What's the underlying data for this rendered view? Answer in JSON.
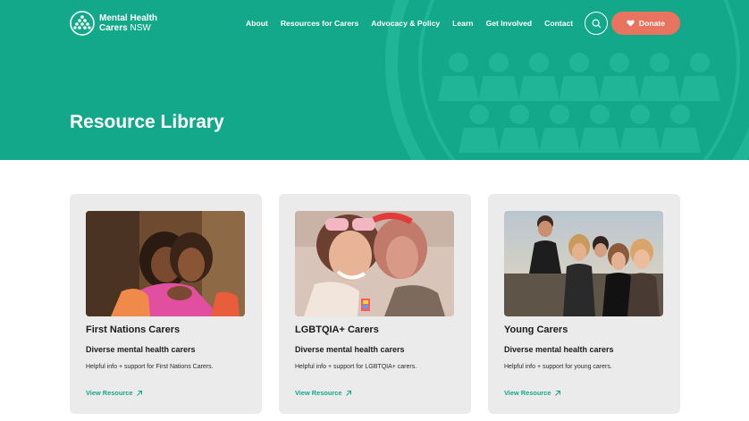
{
  "header": {
    "logo_line1": "Mental Health",
    "logo_line2_bold": "Carers",
    "logo_line2_light": "NSW",
    "nav": [
      "About",
      "Resources for Carers",
      "Advocacy & Policy",
      "Learn",
      "Get Involved",
      "Contact"
    ],
    "search_icon": "search-icon",
    "donate_label": "Donate",
    "donate_icon": "heart-icon"
  },
  "hero": {
    "title": "Resource Library",
    "color": "#14a88a"
  },
  "cards": [
    {
      "title": "First Nations Carers",
      "subtitle": "Diverse mental health carers",
      "description": "Helpful info + support for First Nations Carers.",
      "link": "View Resource"
    },
    {
      "title": "LGBTQIA+ Carers",
      "subtitle": "Diverse mental health carers",
      "description": "Helpful info + support for LGBTQIA+ carers.",
      "link": "View Resource"
    },
    {
      "title": "Young Carers",
      "subtitle": "Diverse mental health carers",
      "description": "Helpful info + support for young carers.",
      "link": "View Resource"
    }
  ],
  "colors": {
    "brand": "#14a88a",
    "donate": "#e8735f",
    "card_bg": "#ebebeb"
  }
}
